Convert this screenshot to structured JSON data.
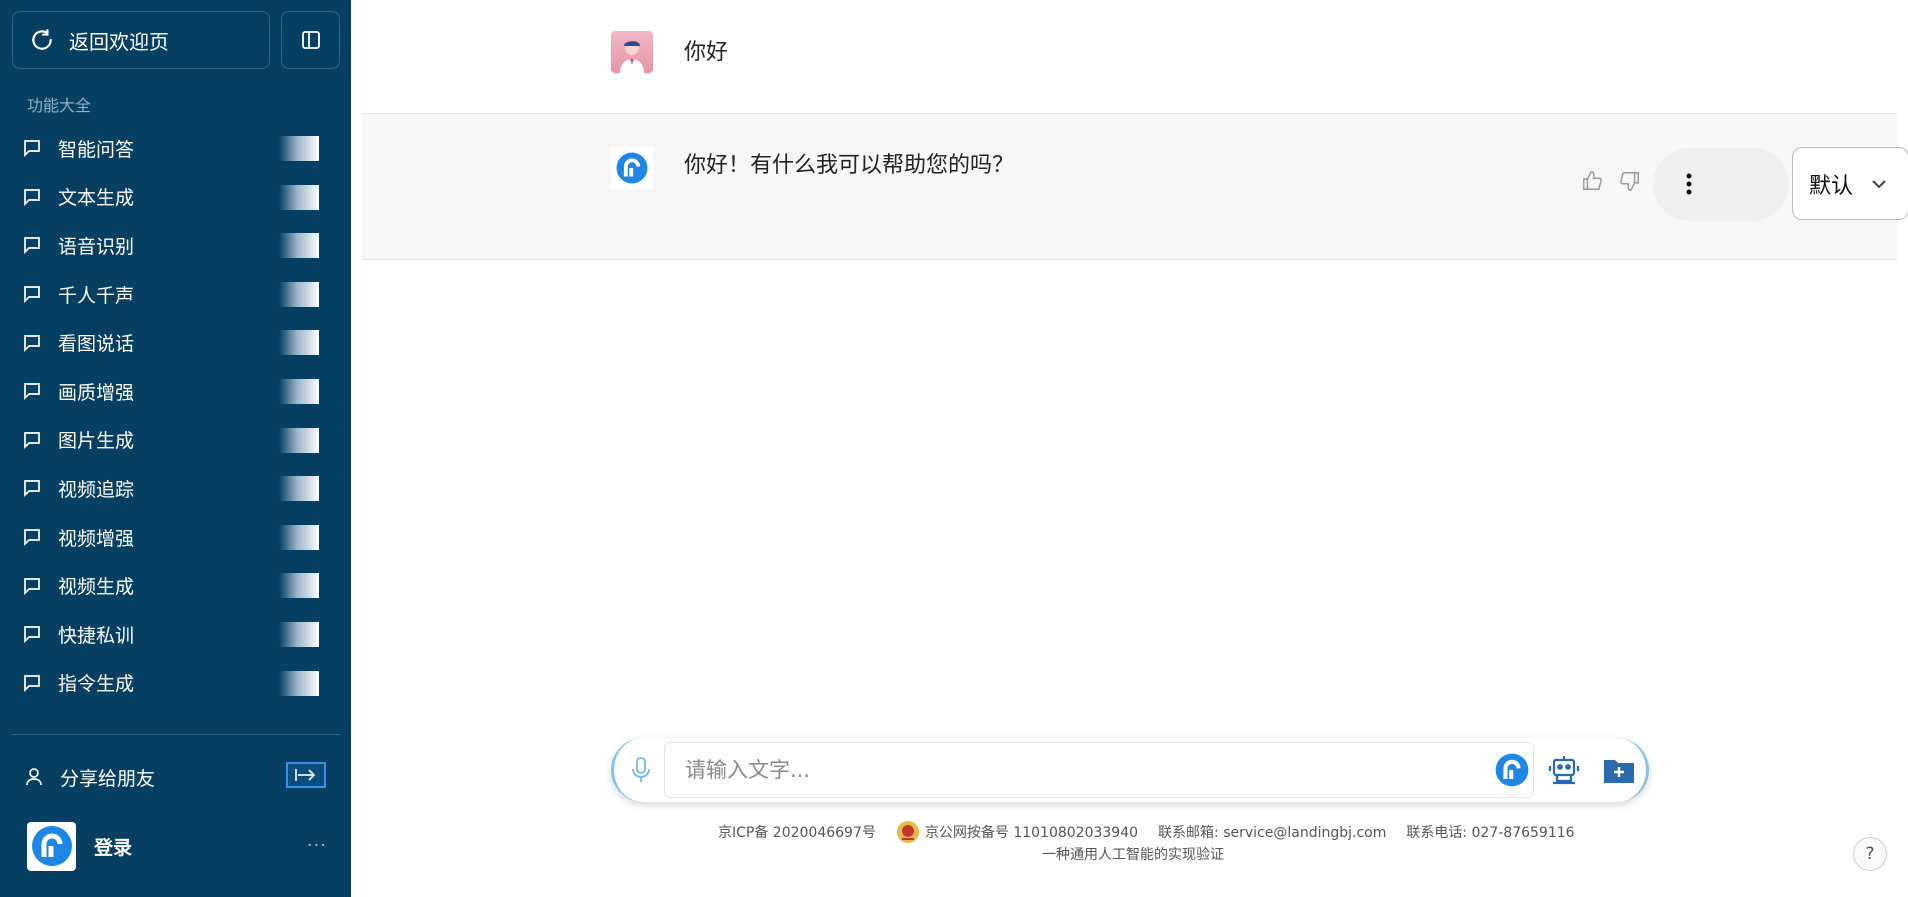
{
  "sidebar": {
    "back_label": "返回欢迎页",
    "section_title": "功能大全",
    "items": [
      {
        "label": "智能问答"
      },
      {
        "label": "文本生成"
      },
      {
        "label": "语音识别"
      },
      {
        "label": "千人千声"
      },
      {
        "label": "看图说话"
      },
      {
        "label": "画质增强"
      },
      {
        "label": "图片生成"
      },
      {
        "label": "视频追踪"
      },
      {
        "label": "视频增强"
      },
      {
        "label": "视频生成"
      },
      {
        "label": "快捷私训"
      },
      {
        "label": "指令生成"
      }
    ],
    "share_label": "分享给朋友",
    "login_label": "登录",
    "more_label": "···"
  },
  "chat": {
    "user_message": "你好",
    "bot_message": "你好！有什么我可以帮助您的吗？",
    "mode_value": "默认"
  },
  "input": {
    "placeholder": "请输入文字..."
  },
  "footer": {
    "icp": "京ICP备 2020046697号",
    "police": "京公网按备号 11010802033940",
    "email": "联系邮箱: service@landingbj.com",
    "phone": "联系电话: 027-87659116",
    "slogan": "一种通用人工智能的实现验证"
  },
  "help_label": "?",
  "colors": {
    "sidebar_bg": "#073f62",
    "accent_blue": "#1e86e5"
  },
  "icons": [
    "refresh-icon",
    "sidebar-toggle-icon",
    "chat-bubble-icon",
    "user-icon",
    "share-arrow-icon",
    "logo-icon",
    "thumbs-up-icon",
    "thumbs-down-icon",
    "more-vertical-icon",
    "chevron-down-icon",
    "microphone-icon",
    "robot-icon",
    "folder-add-icon",
    "police-badge-icon"
  ]
}
